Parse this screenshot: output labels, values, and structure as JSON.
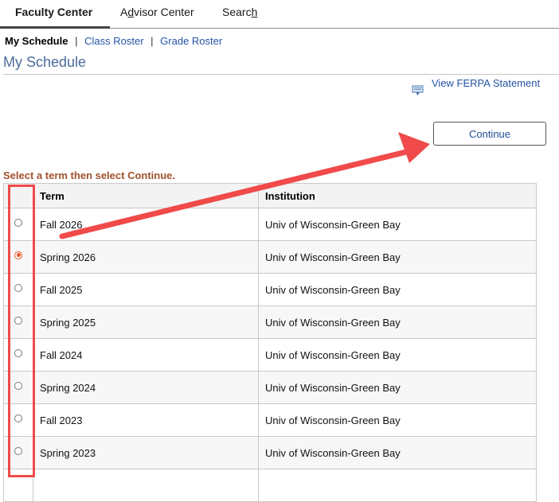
{
  "tabs": [
    {
      "label": "Faculty Center",
      "active": true
    },
    {
      "label_pre": "A",
      "label_u": "d",
      "label_post": "visor Center"
    },
    {
      "label_pre": "Searc",
      "label_u": "h",
      "label_post": ""
    }
  ],
  "subnav": {
    "current": "My Schedule",
    "sep": "|",
    "links": [
      "Class Roster",
      "Grade Roster"
    ]
  },
  "page_title": "My Schedule",
  "ferpa": {
    "label": "View FERPA Statement",
    "icon": "document-icon"
  },
  "continue_label": "Continue",
  "instruction": "Select a term then select Continue.",
  "table": {
    "headers": [
      "",
      "Term",
      "Institution"
    ],
    "rows": [
      {
        "term": "Fall 2026",
        "institution": "Univ of Wisconsin-Green Bay",
        "selected": false
      },
      {
        "term": "Spring 2026",
        "institution": "Univ of Wisconsin-Green Bay",
        "selected": true
      },
      {
        "term": "Fall 2025",
        "institution": "Univ of Wisconsin-Green Bay",
        "selected": false
      },
      {
        "term": "Spring 2025",
        "institution": "Univ of Wisconsin-Green Bay",
        "selected": false
      },
      {
        "term": "Fall 2024",
        "institution": "Univ of Wisconsin-Green Bay",
        "selected": false
      },
      {
        "term": "Spring 2024",
        "institution": "Univ of Wisconsin-Green Bay",
        "selected": false
      },
      {
        "term": "Fall 2023",
        "institution": "Univ of Wisconsin-Green Bay",
        "selected": false
      },
      {
        "term": "Spring 2023",
        "institution": "Univ of Wisconsin-Green Bay",
        "selected": false
      }
    ]
  },
  "colors": {
    "accent": "#2354a5",
    "selected_radio": "#e5542a",
    "annotation": "#f04a4a",
    "instruction": "#a0522d"
  }
}
